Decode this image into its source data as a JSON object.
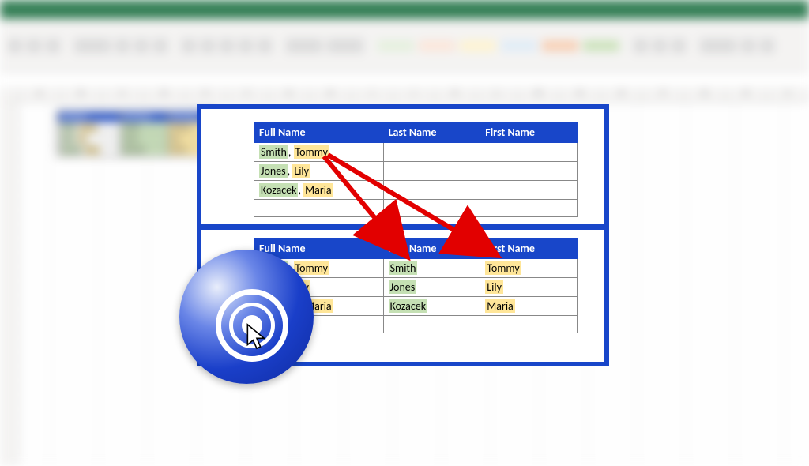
{
  "headers": {
    "full": "Full Name",
    "last": "Last Name",
    "first": "First Name"
  },
  "rows": [
    {
      "full_last": "Smith",
      "full_sep": ", ",
      "full_first": "Tommy",
      "last": "Smith",
      "first": "Tommy"
    },
    {
      "full_last": "Jones",
      "full_sep": ", ",
      "full_first": "Lily",
      "last": "Jones",
      "first": "Lily"
    },
    {
      "full_last": "Kozacek",
      "full_sep": ", ",
      "full_first": "Maria",
      "last": "Kozacek",
      "first": "Maria"
    }
  ],
  "cols": [
    "A",
    "B",
    "C",
    "D",
    "E",
    "F",
    "G",
    "H",
    "I",
    "J",
    "K",
    "L",
    "M",
    "N",
    "O",
    "P",
    "Q",
    "R",
    "S"
  ],
  "chip_colors": [
    "#e2efda",
    "#fce4d6",
    "#fff2cc",
    "#ddebf7",
    "#f8cbad",
    "#c6e0b4"
  ]
}
